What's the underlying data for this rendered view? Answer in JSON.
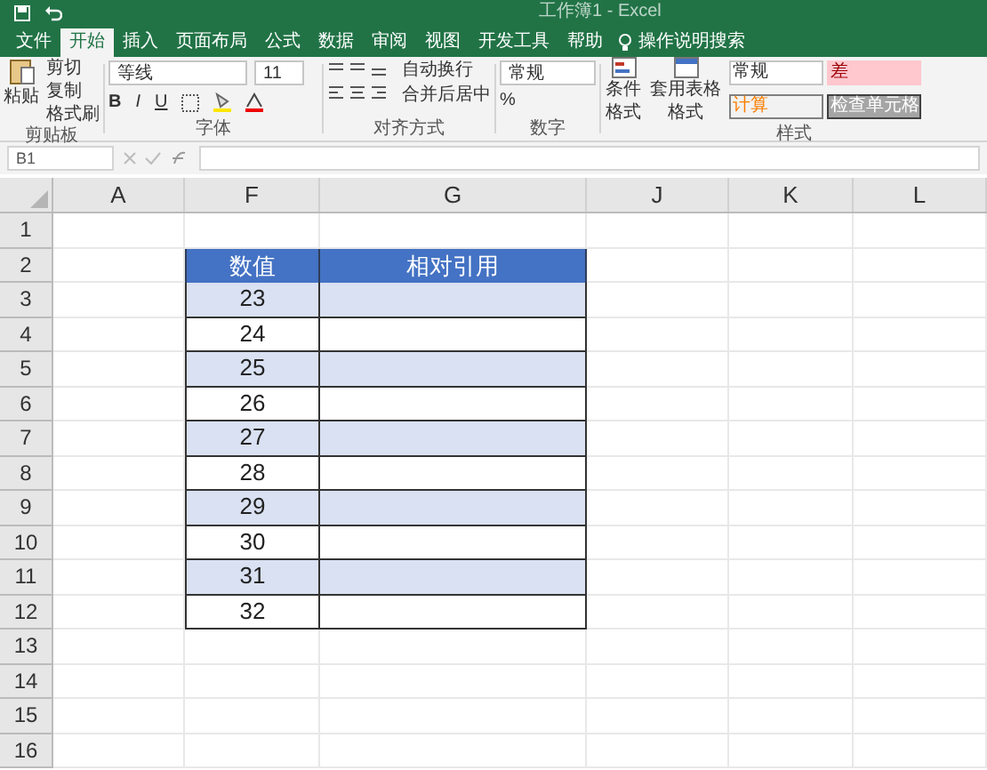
{
  "window": {
    "title": "工作簿1 - Excel"
  },
  "tabs": [
    {
      "label": "文件",
      "selected": false
    },
    {
      "label": "开始",
      "selected": true
    },
    {
      "label": "插入",
      "selected": false
    },
    {
      "label": "页面布局",
      "selected": false
    },
    {
      "label": "公式",
      "selected": false
    },
    {
      "label": "数据",
      "selected": false
    },
    {
      "label": "审阅",
      "selected": false
    },
    {
      "label": "视图",
      "selected": false
    },
    {
      "label": "开发工具",
      "selected": false
    },
    {
      "label": "帮助",
      "selected": false
    }
  ],
  "tell_me": {
    "placeholder": "操作说明搜索"
  },
  "ribbon": {
    "clipboard": {
      "paste": "粘贴",
      "cut": "剪切",
      "copy": "复制",
      "format_painter": "格式刷",
      "label": "剪贴板"
    },
    "font": {
      "font_name": "等线",
      "font_size": "11",
      "bold": "B",
      "italic": "I",
      "underline": "U",
      "label": "字体"
    },
    "alignment": {
      "wrap": "自动换行",
      "merge": "合并后居中",
      "label": "对齐方式"
    },
    "number": {
      "format": "常规",
      "percent": "%",
      "label": "数字"
    },
    "styles": {
      "conditional": "条件格式",
      "table_format": "套用表格格式",
      "cells": [
        {
          "label": "常规",
          "kind": "normal"
        },
        {
          "label": "差",
          "kind": "bad"
        },
        {
          "label": "计算",
          "kind": "calc"
        },
        {
          "label": "检查单元格",
          "kind": "check"
        }
      ],
      "label": "样式"
    }
  },
  "name_box": "B1",
  "columns": [
    "A",
    "F",
    "G",
    "J",
    "K",
    "L"
  ],
  "row_numbers": [
    "1",
    "2",
    "3",
    "4",
    "5",
    "6",
    "7",
    "8",
    "9",
    "10",
    "11",
    "12",
    "13",
    "14",
    "15",
    "16"
  ],
  "table": {
    "headers": [
      "数值",
      "相对引用"
    ],
    "rows": [
      {
        "value": "23",
        "banded": true
      },
      {
        "value": "24",
        "banded": false
      },
      {
        "value": "25",
        "banded": true
      },
      {
        "value": "26",
        "banded": false
      },
      {
        "value": "27",
        "banded": true
      },
      {
        "value": "28",
        "banded": false
      },
      {
        "value": "29",
        "banded": true
      },
      {
        "value": "30",
        "banded": false
      },
      {
        "value": "31",
        "banded": true
      },
      {
        "value": "32",
        "banded": false
      }
    ]
  }
}
